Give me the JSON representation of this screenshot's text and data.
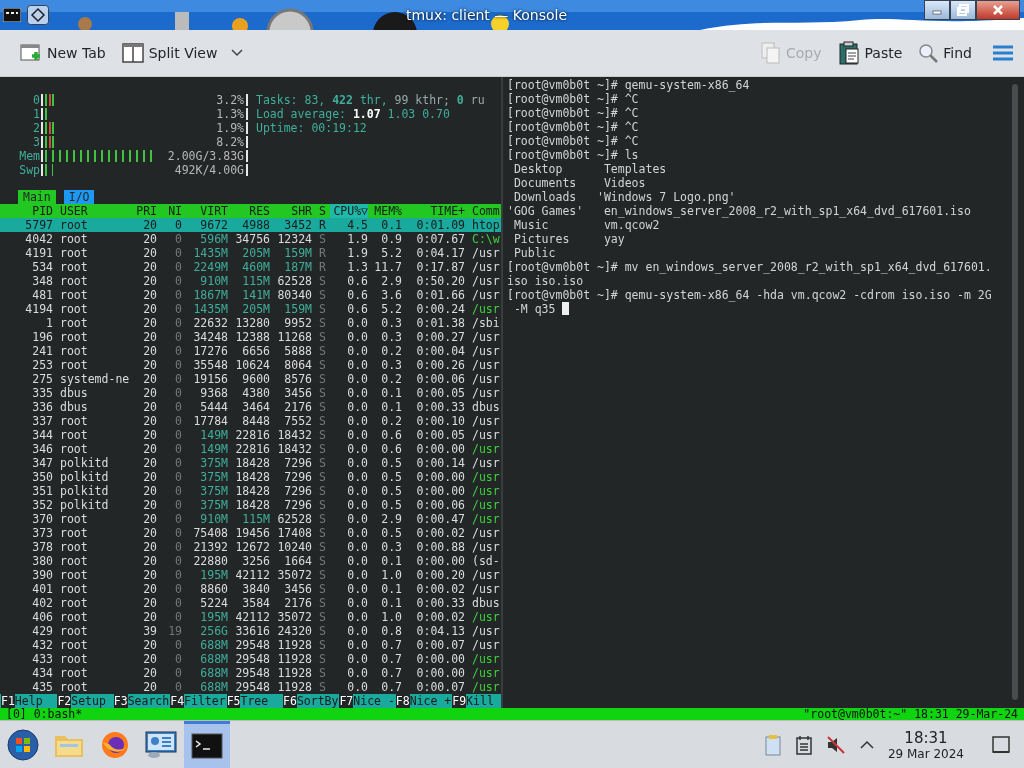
{
  "window": {
    "title": "tmux: client — Konsole"
  },
  "toolbar": [
    {
      "kind": "new-tab",
      "label": "New Tab",
      "disabled": false
    },
    {
      "kind": "split-view",
      "label": "Split View",
      "disabled": false
    },
    {
      "kind": "copy",
      "label": "Copy",
      "disabled": true
    },
    {
      "kind": "paste",
      "label": "Paste",
      "disabled": false
    },
    {
      "kind": "find",
      "label": "Find",
      "disabled": false
    }
  ],
  "htop": {
    "meters": [
      {
        "label": "0",
        "level": 0.05,
        "reading": "3.2%"
      },
      {
        "label": "1",
        "level": 0.02,
        "reading": "1.3%"
      },
      {
        "label": "2",
        "level": 0.05,
        "reading": "1.9%"
      },
      {
        "label": "3",
        "level": 0.05,
        "reading": "8.2%"
      },
      {
        "label": "Mem",
        "level": 0.56,
        "reading": "2.00G/3.83G"
      },
      {
        "label": "Swp",
        "level": 0.04,
        "reading": "492K/4.00G"
      }
    ],
    "info": [
      [
        {
          "text": "Tasks: ",
          "kind": "label"
        },
        {
          "text": "83",
          "kind": "value"
        },
        {
          "text": ", ",
          "kind": "label"
        },
        {
          "text": "422",
          "kind": "strong"
        },
        {
          "text": " thr, ",
          "kind": "label"
        },
        {
          "text": "99",
          "kind": "dim"
        },
        {
          "text": " kthr; ",
          "kind": "dim"
        },
        {
          "text": "0",
          "kind": "strong"
        },
        {
          "text": " ru",
          "kind": "dim"
        }
      ],
      [
        {
          "text": "Load average: ",
          "kind": "label"
        },
        {
          "text": "1.07",
          "kind": "bright"
        },
        {
          "text": " 1.03",
          "kind": "value"
        },
        {
          "text": " 0.70",
          "kind": "value"
        }
      ],
      [
        {
          "text": "Uptime: ",
          "kind": "label"
        },
        {
          "text": "00:19:12",
          "kind": "value"
        }
      ]
    ],
    "tabs": [
      {
        "label": "Main",
        "selected": true
      },
      {
        "label": "I/O",
        "selected": false
      }
    ],
    "columns": [
      {
        "label": "PID",
        "selected": false
      },
      {
        "label": "USER",
        "selected": false
      },
      {
        "label": "PRI",
        "selected": false
      },
      {
        "label": "NI",
        "selected": false
      },
      {
        "label": "VIRT",
        "selected": false
      },
      {
        "label": "RES",
        "selected": false
      },
      {
        "label": "SHR",
        "selected": false
      },
      {
        "label": "S",
        "selected": false
      },
      {
        "label": "CPU%▽",
        "selected": true
      },
      {
        "label": "MEM%",
        "selected": false
      },
      {
        "label": "TIME+",
        "selected": false
      },
      {
        "label": "Comm",
        "selected": false
      }
    ],
    "rows": [
      {
        "cells": [
          "5797",
          "root",
          "20",
          "0",
          "9672",
          "4988",
          "3452",
          "R",
          "4.5",
          "0.1",
          "0:01.09",
          "htop"
        ],
        "selected": true,
        "thread": false
      },
      {
        "cells": [
          "4042",
          "root",
          "20",
          "0",
          "596M",
          "34756",
          "12324",
          "S",
          "1.9",
          "0.9",
          "0:07.67",
          "C:\\w"
        ],
        "selected": false,
        "thread": true
      },
      {
        "cells": [
          "4191",
          "root",
          "20",
          "0",
          "1435M",
          "205M",
          "159M",
          "R",
          "1.9",
          "5.2",
          "0:04.17",
          "/usr"
        ],
        "selected": false,
        "thread": false
      },
      {
        "cells": [
          "534",
          "root",
          "20",
          "0",
          "2249M",
          "460M",
          "187M",
          "R",
          "1.3",
          "11.7",
          "0:17.87",
          "/usr"
        ],
        "selected": false,
        "thread": false
      },
      {
        "cells": [
          "348",
          "root",
          "20",
          "0",
          "910M",
          "115M",
          "62528",
          "S",
          "0.6",
          "2.9",
          "0:50.20",
          "/usr"
        ],
        "selected": false,
        "thread": false
      },
      {
        "cells": [
          "481",
          "root",
          "20",
          "0",
          "1867M",
          "141M",
          "80340",
          "S",
          "0.6",
          "3.6",
          "0:01.66",
          "/usr"
        ],
        "selected": false,
        "thread": false
      },
      {
        "cells": [
          "4194",
          "root",
          "20",
          "0",
          "1435M",
          "205M",
          "159M",
          "S",
          "0.6",
          "5.2",
          "0:00.24",
          "/usr"
        ],
        "selected": false,
        "thread": true
      },
      {
        "cells": [
          "1",
          "root",
          "20",
          "0",
          "22632",
          "13280",
          "9952",
          "S",
          "0.0",
          "0.3",
          "0:01.38",
          "/sbi"
        ],
        "selected": false,
        "thread": false
      },
      {
        "cells": [
          "196",
          "root",
          "20",
          "0",
          "34248",
          "12388",
          "11268",
          "S",
          "0.0",
          "0.3",
          "0:00.27",
          "/usr"
        ],
        "selected": false,
        "thread": false
      },
      {
        "cells": [
          "241",
          "root",
          "20",
          "0",
          "17276",
          "6656",
          "5888",
          "S",
          "0.0",
          "0.2",
          "0:00.04",
          "/usr"
        ],
        "selected": false,
        "thread": false
      },
      {
        "cells": [
          "253",
          "root",
          "20",
          "0",
          "35548",
          "10624",
          "8064",
          "S",
          "0.0",
          "0.3",
          "0:00.26",
          "/usr"
        ],
        "selected": false,
        "thread": false
      },
      {
        "cells": [
          "275",
          "systemd-ne",
          "20",
          "0",
          "19156",
          "9600",
          "8576",
          "S",
          "0.0",
          "0.2",
          "0:00.06",
          "/usr"
        ],
        "selected": false,
        "thread": false
      },
      {
        "cells": [
          "335",
          "dbus",
          "20",
          "0",
          "9368",
          "4380",
          "3456",
          "S",
          "0.0",
          "0.1",
          "0:00.05",
          "/usr"
        ],
        "selected": false,
        "thread": false
      },
      {
        "cells": [
          "336",
          "dbus",
          "20",
          "0",
          "5444",
          "3464",
          "2176",
          "S",
          "0.0",
          "0.1",
          "0:00.33",
          "dbus"
        ],
        "selected": false,
        "thread": false
      },
      {
        "cells": [
          "337",
          "root",
          "20",
          "0",
          "17784",
          "8448",
          "7552",
          "S",
          "0.0",
          "0.2",
          "0:00.10",
          "/usr"
        ],
        "selected": false,
        "thread": false
      },
      {
        "cells": [
          "344",
          "root",
          "20",
          "0",
          "149M",
          "22816",
          "18432",
          "S",
          "0.0",
          "0.6",
          "0:00.05",
          "/usr"
        ],
        "selected": false,
        "thread": false
      },
      {
        "cells": [
          "346",
          "root",
          "20",
          "0",
          "149M",
          "22816",
          "18432",
          "S",
          "0.0",
          "0.6",
          "0:00.00",
          "/usr"
        ],
        "selected": false,
        "thread": true
      },
      {
        "cells": [
          "347",
          "polkitd",
          "20",
          "0",
          "375M",
          "18428",
          "7296",
          "S",
          "0.0",
          "0.5",
          "0:00.14",
          "/usr"
        ],
        "selected": false,
        "thread": false
      },
      {
        "cells": [
          "350",
          "polkitd",
          "20",
          "0",
          "375M",
          "18428",
          "7296",
          "S",
          "0.0",
          "0.5",
          "0:00.00",
          "/usr"
        ],
        "selected": false,
        "thread": true
      },
      {
        "cells": [
          "351",
          "polkitd",
          "20",
          "0",
          "375M",
          "18428",
          "7296",
          "S",
          "0.0",
          "0.5",
          "0:00.00",
          "/usr"
        ],
        "selected": false,
        "thread": true
      },
      {
        "cells": [
          "352",
          "polkitd",
          "20",
          "0",
          "375M",
          "18428",
          "7296",
          "S",
          "0.0",
          "0.5",
          "0:00.06",
          "/usr"
        ],
        "selected": false,
        "thread": true
      },
      {
        "cells": [
          "370",
          "root",
          "20",
          "0",
          "910M",
          "115M",
          "62528",
          "S",
          "0.0",
          "2.9",
          "0:00.47",
          "/usr"
        ],
        "selected": false,
        "thread": true
      },
      {
        "cells": [
          "373",
          "root",
          "20",
          "0",
          "75408",
          "19456",
          "17408",
          "S",
          "0.0",
          "0.5",
          "0:00.02",
          "/usr"
        ],
        "selected": false,
        "thread": false
      },
      {
        "cells": [
          "378",
          "root",
          "20",
          "0",
          "21392",
          "12672",
          "10240",
          "S",
          "0.0",
          "0.3",
          "0:00.88",
          "/usr"
        ],
        "selected": false,
        "thread": false
      },
      {
        "cells": [
          "380",
          "root",
          "20",
          "0",
          "22880",
          "3256",
          "1664",
          "S",
          "0.0",
          "0.1",
          "0:00.00",
          "(sd-"
        ],
        "selected": false,
        "thread": false
      },
      {
        "cells": [
          "390",
          "root",
          "20",
          "0",
          "195M",
          "42112",
          "35072",
          "S",
          "0.0",
          "1.0",
          "0:00.20",
          "/usr"
        ],
        "selected": false,
        "thread": false
      },
      {
        "cells": [
          "401",
          "root",
          "20",
          "0",
          "8860",
          "3840",
          "3456",
          "S",
          "0.0",
          "0.1",
          "0:00.02",
          "/usr"
        ],
        "selected": false,
        "thread": false
      },
      {
        "cells": [
          "402",
          "root",
          "20",
          "0",
          "5224",
          "3584",
          "2176",
          "S",
          "0.0",
          "0.1",
          "0:00.33",
          "dbus"
        ],
        "selected": false,
        "thread": false
      },
      {
        "cells": [
          "406",
          "root",
          "20",
          "0",
          "195M",
          "42112",
          "35072",
          "S",
          "0.0",
          "1.0",
          "0:00.02",
          "/usr"
        ],
        "selected": false,
        "thread": true
      },
      {
        "cells": [
          "429",
          "root",
          "39",
          "19",
          "256G",
          "33616",
          "24320",
          "S",
          "0.0",
          "0.8",
          "0:04.13",
          "/usr"
        ],
        "selected": false,
        "thread": false
      },
      {
        "cells": [
          "432",
          "root",
          "20",
          "0",
          "688M",
          "29548",
          "11928",
          "S",
          "0.0",
          "0.7",
          "0:00.07",
          "/usr"
        ],
        "selected": false,
        "thread": false
      },
      {
        "cells": [
          "433",
          "root",
          "20",
          "0",
          "688M",
          "29548",
          "11928",
          "S",
          "0.0",
          "0.7",
          "0:00.00",
          "/usr"
        ],
        "selected": false,
        "thread": true
      },
      {
        "cells": [
          "434",
          "root",
          "20",
          "0",
          "688M",
          "29548",
          "11928",
          "S",
          "0.0",
          "0.7",
          "0:00.00",
          "/usr"
        ],
        "selected": false,
        "thread": true
      },
      {
        "cells": [
          "435",
          "root",
          "20",
          "0",
          "688M",
          "29548",
          "11928",
          "S",
          "0.0",
          "0.7",
          "0:00.07",
          "/usr"
        ],
        "selected": false,
        "thread": true
      }
    ],
    "function_keys": [
      {
        "key": "F1",
        "label": "Help  "
      },
      {
        "key": "F2",
        "label": "Setup "
      },
      {
        "key": "F3",
        "label": "Search"
      },
      {
        "key": "F4",
        "label": "Filter"
      },
      {
        "key": "F5",
        "label": "Tree  "
      },
      {
        "key": "F6",
        "label": "SortBy"
      },
      {
        "key": "F7",
        "label": "Nice -"
      },
      {
        "key": "F8",
        "label": "Nice +"
      },
      {
        "key": "F9",
        "label": "Kill  "
      }
    ]
  },
  "shell": {
    "lines": [
      "[root@vm0b0t ~]# qemu-system-x86_64",
      "[root@vm0b0t ~]# ^C",
      "[root@vm0b0t ~]# ^C",
      "[root@vm0b0t ~]# ^C",
      "[root@vm0b0t ~]# ^C",
      "[root@vm0b0t ~]# ls",
      " Desktop      Templates",
      " Documents    Videos",
      " Downloads   'Windows 7 Logo.png'",
      "'GOG Games'   en_windows_server_2008_r2_with_sp1_x64_dvd_617601.iso",
      " Music        vm.qcow2",
      " Pictures     yay",
      " Public",
      "[root@vm0b0t ~]# mv en_windows_server_2008_r2_with_sp1_x64_dvd_617601.",
      "iso iso.iso",
      "[root@vm0b0t ~]# qemu-system-x86_64 -hda vm.qcow2 -cdrom iso.iso -m 2G",
      " -M q35 "
    ]
  },
  "tmux_status": {
    "left": "[0] 0:bash*",
    "right": "\"root@vm0b0t:~\" 18:31 29-Mar-24"
  },
  "taskbar": {
    "apps": [
      {
        "kind": "folder",
        "selected": false
      },
      {
        "kind": "browser",
        "selected": false
      },
      {
        "kind": "remote",
        "selected": false
      },
      {
        "kind": "terminal",
        "selected": true
      }
    ],
    "clock": {
      "time": "18:31",
      "date": "29 Mar 2024"
    }
  }
}
